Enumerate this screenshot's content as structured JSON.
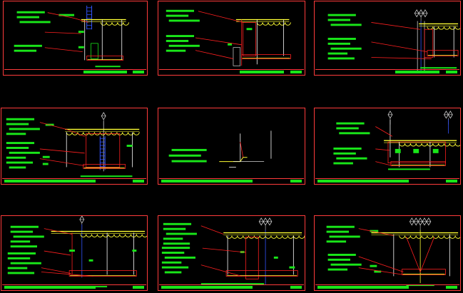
{
  "drawing_set": {
    "background": "#000000",
    "colors": {
      "frame": "#ff3b3b",
      "annotation_block": "#19e619",
      "leader": "#ff2020",
      "steel": "#ffff33",
      "rebar": "#3355ff",
      "marker": "#cfcfcf",
      "white": "#ffffff"
    },
    "sheets": [
      {
        "id": "sheet-1",
        "variant": "section-post-left"
      },
      {
        "id": "sheet-2",
        "variant": "section-foundation"
      },
      {
        "id": "sheet-3",
        "variant": "section-light-pole"
      },
      {
        "id": "sheet-4",
        "variant": "section-ladder"
      },
      {
        "id": "sheet-5",
        "variant": "section-edge-detail"
      },
      {
        "id": "sheet-6",
        "variant": "section-twin-poles"
      },
      {
        "id": "sheet-7",
        "variant": "section-wide-left"
      },
      {
        "id": "sheet-8",
        "variant": "section-wide-center"
      },
      {
        "id": "sheet-9",
        "variant": "section-wide-lamp"
      }
    ]
  }
}
